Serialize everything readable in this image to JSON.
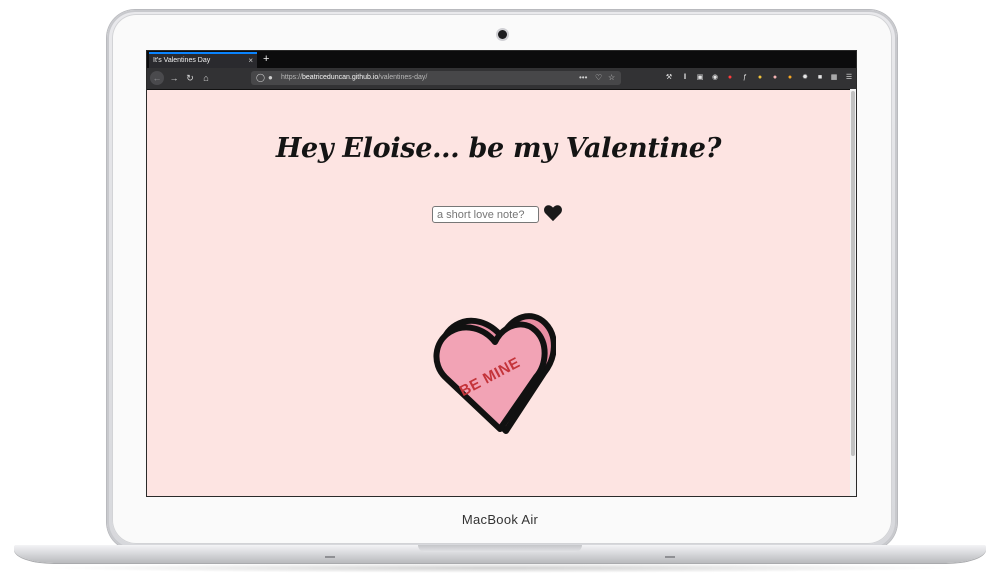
{
  "browser": {
    "tab_title": "It's Valentines Day",
    "tab_close": "×",
    "new_tab": "+",
    "url_protocol": "https://",
    "url_host": "beatriceduncan.github.io",
    "url_path": "/valentines-day/",
    "url_more": "•••"
  },
  "page": {
    "title": "Hey Eloise... be my Valentine?",
    "note_placeholder": "a short love note?",
    "note_value": "",
    "candy_text": "BE MINE"
  },
  "laptop": {
    "brand": "MacBook Air"
  },
  "colors": {
    "page_background": "#fde4e2",
    "candy_fill": "#f2a3b5",
    "candy_side": "#e88ea3",
    "candy_text": "#c4343a",
    "heart_button": "#1a1a1a"
  },
  "icons": [
    "back-arrow-icon",
    "forward-arrow-icon",
    "reload-icon",
    "home-icon",
    "shield-icon",
    "lock-icon",
    "pocket-icon",
    "star-icon",
    "wrench-icon",
    "library-icon",
    "sidebar-icon",
    "extension-icons",
    "menu-icon",
    "heart-icon"
  ]
}
